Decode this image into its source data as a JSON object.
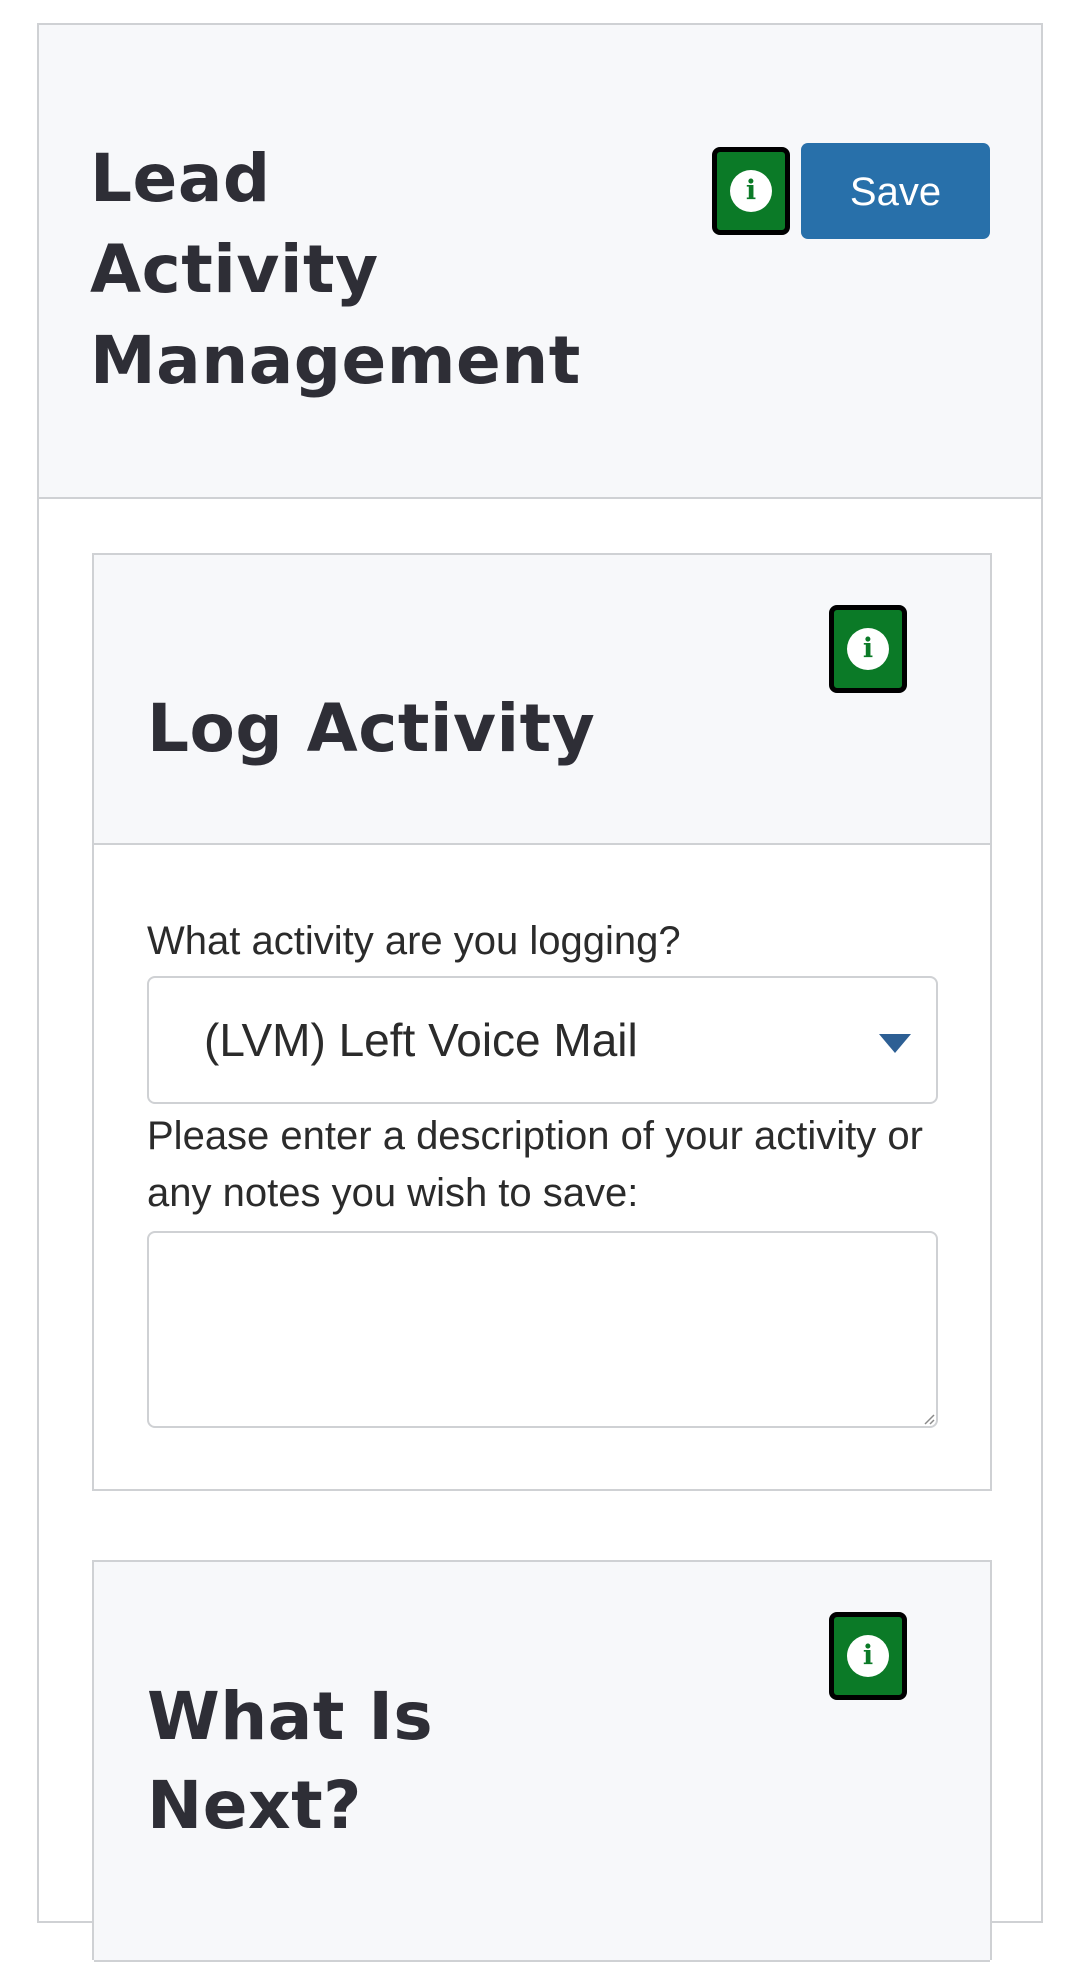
{
  "header": {
    "title_lines": [
      "Lead",
      "Activity",
      "Management"
    ],
    "save_label": "Save",
    "info_icon_glyph": "i"
  },
  "log_activity": {
    "title": "Log Activity",
    "activity_label": "What activity are you logging?",
    "activity_selected": "(LVM) Left Voice Mail",
    "description_label": "Please enter a description of your activity or any notes you wish to save:",
    "description_value": ""
  },
  "what_is_next": {
    "title_lines": [
      "What Is",
      "Next?"
    ]
  },
  "colors": {
    "save_button": "#2870aa",
    "info_button": "#0b7a27",
    "header_background": "#f7f8fa",
    "border": "#cfd1d4",
    "dropdown_arrow": "#2d5f94"
  },
  "icons": {
    "info": "info-circle-icon",
    "dropdown": "caret-down-icon",
    "resize": "resize-grip-icon"
  }
}
